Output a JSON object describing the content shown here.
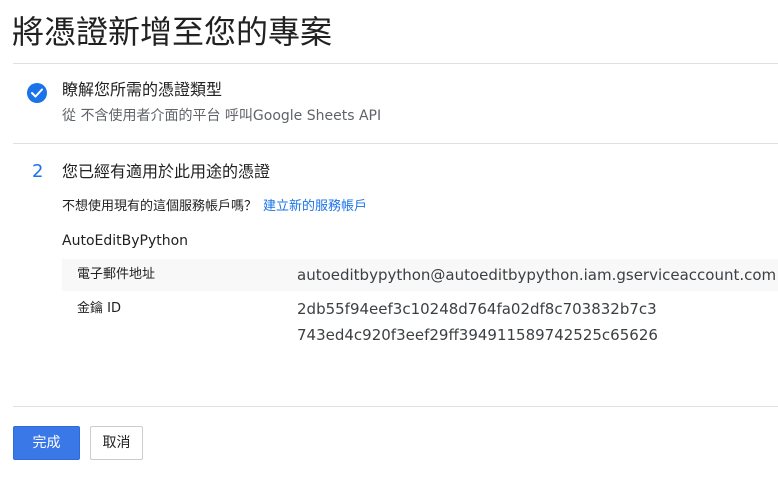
{
  "page": {
    "title": "將憑證新增至您的專案"
  },
  "step1": {
    "icon": "check-circle-icon",
    "title": "瞭解您所需的憑證類型",
    "subtitle": "從 不含使用者介面的平台 呼叫Google Sheets API"
  },
  "step2": {
    "number": "2",
    "title": "您已經有適用於此用途的憑證",
    "question": "不想使用現有的這個服務帳戶嗎？",
    "create_link": "建立新的服務帳戶",
    "account_name": "AutoEditByPython",
    "details": {
      "email_label": "電子郵件地址",
      "email_value": "autoeditbypython@autoeditbypython.iam.gserviceaccount.com",
      "key_label": "金鑰 ID",
      "key_value_line1": "2db55f94eef3c10248d764fa02df8c703832b7c3",
      "key_value_line2": "743ed4c920f3eef29ff394911589742525c65626"
    }
  },
  "actions": {
    "done_label": "完成",
    "cancel_label": "取消"
  },
  "colors": {
    "accent": "#1a73e8",
    "primary_button": "#3b78e7"
  }
}
